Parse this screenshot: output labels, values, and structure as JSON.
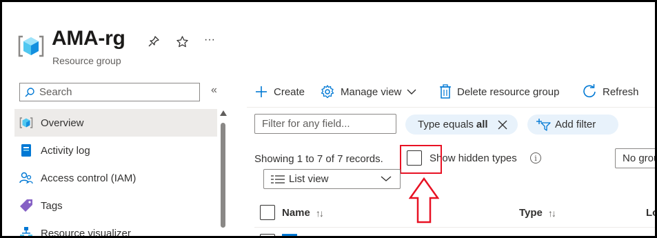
{
  "header": {
    "title": "AMA-rg",
    "subtitle": "Resource group",
    "pin_icon": "pin-icon",
    "favorite_icon": "star-icon",
    "more_label": "···"
  },
  "sidebar": {
    "search_placeholder": "Search",
    "collapse_label": "«",
    "items": [
      {
        "label": "Overview",
        "icon": "resource-group-icon",
        "active": true
      },
      {
        "label": "Activity log",
        "icon": "activity-log-icon"
      },
      {
        "label": "Access control (IAM)",
        "icon": "people-icon"
      },
      {
        "label": "Tags",
        "icon": "tag-icon"
      },
      {
        "label": "Resource visualizer",
        "icon": "visualizer-icon"
      }
    ]
  },
  "toolbar": {
    "create_label": "Create",
    "manage_view_label": "Manage view",
    "delete_label": "Delete resource group",
    "refresh_label": "Refresh"
  },
  "filters": {
    "filter_placeholder": "Filter for any field...",
    "type_filter_prefix": "Type equals",
    "type_filter_value": "all",
    "add_filter_label": "Add filter"
  },
  "list": {
    "records_text": "Showing 1 to 7 of 7 records.",
    "show_hidden_label": "Show hidden types",
    "show_hidden_checked": false,
    "grouping_value": "No grou",
    "view_mode": "List view",
    "columns": [
      {
        "label": "Name",
        "sort": "↑↓"
      },
      {
        "label": "Type",
        "sort": "↑↓"
      },
      {
        "label": "Lo"
      }
    ]
  },
  "colors": {
    "accent": "#0078d4",
    "annotation": "#e81123",
    "pill_bg": "#e8f2fb"
  }
}
